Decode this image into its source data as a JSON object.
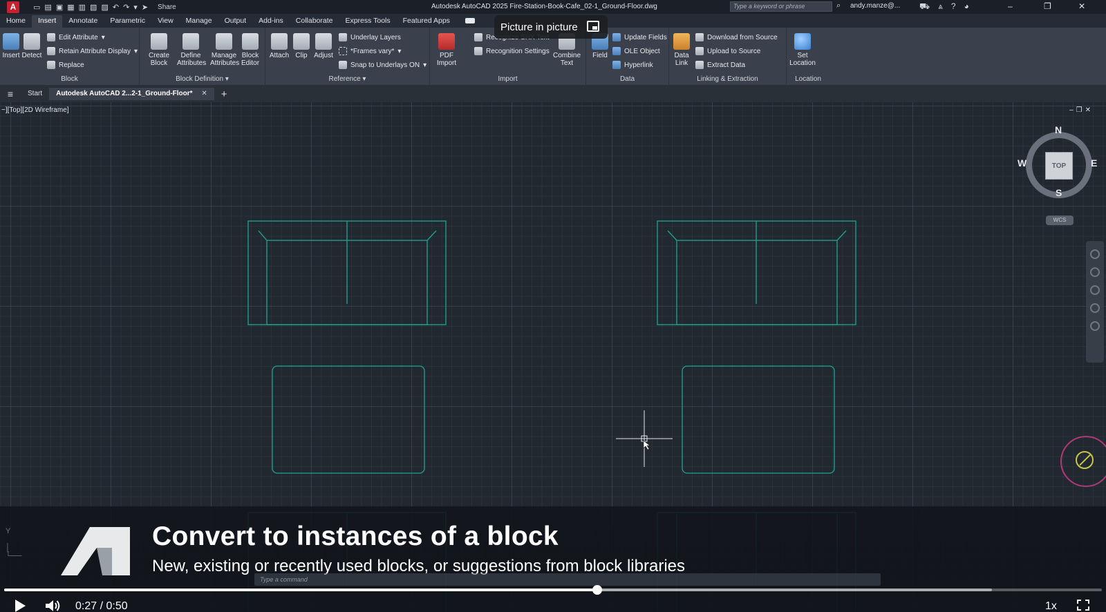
{
  "titlebar": {
    "app_logo": "A",
    "share_label": "Share",
    "title": "Autodesk AutoCAD 2025  Fire-Station-Book-Cafe_02-1_Ground-Floor.dwg",
    "search_placeholder": "Type a keyword or phrase",
    "user": "andy.manze@..."
  },
  "tabs": [
    "Home",
    "Insert",
    "Annotate",
    "Parametric",
    "View",
    "Manage",
    "Output",
    "Add-ins",
    "Collaborate",
    "Express Tools",
    "Featured Apps"
  ],
  "active_tab": "Insert",
  "ribbon": {
    "block": {
      "label": "Block",
      "insert": "Insert",
      "detect": "Detect",
      "edit_attribute": "Edit Attribute",
      "retain_attribute_display": "Retain Attribute Display",
      "replace": "Replace"
    },
    "block_definition": {
      "label": "Block Definition",
      "create_block": [
        "Create",
        "Block"
      ],
      "define_attributes": [
        "Define",
        "Attributes"
      ],
      "manage_attributes": [
        "Manage",
        "Attributes"
      ],
      "block_editor": [
        "Block",
        "Editor"
      ]
    },
    "reference": {
      "label": "Reference",
      "attach": "Attach",
      "clip": "Clip",
      "adjust": "Adjust",
      "underlay_layers": "Underlay Layers",
      "frames_vary": "*Frames vary*",
      "snap_to_underlays": "Snap to Underlays ON"
    },
    "import": {
      "label": "Import",
      "pdf_import": [
        "PDF",
        "Import"
      ],
      "recognize_shx": "Recognize SHX Text",
      "recognition_settings": "Recognition Settings",
      "combine_text": [
        "Combine",
        "Text"
      ]
    },
    "data": {
      "label": "Data",
      "field": "Field",
      "update_fields": "Update Fields",
      "ole_object": "OLE Object",
      "hyperlink": "Hyperlink"
    },
    "linking": {
      "label": "Linking & Extraction",
      "data_link": [
        "Data",
        "Link"
      ],
      "download_from_source": "Download from Source",
      "upload_to_source": "Upload to Source",
      "extract_data": "Extract  Data"
    },
    "location": {
      "label": "Location",
      "set_location": [
        "Set",
        "Location"
      ]
    }
  },
  "filetabs": {
    "start": "Start",
    "active": "Autodesk AutoCAD 2...2-1_Ground-Floor*"
  },
  "viewport": {
    "label": "−][Top][2D Wireframe]",
    "viewcube": {
      "top": "TOP",
      "n": "N",
      "s": "S",
      "e": "E",
      "w": "W"
    },
    "wcs": "WCS"
  },
  "pip": {
    "label": "Picture in picture"
  },
  "caption": {
    "title": "Convert to instances of a block",
    "subtitle": "New, existing or recently used blocks, or suggestions from block libraries",
    "command_placeholder": "Type a command"
  },
  "video": {
    "current_time": "0:27",
    "duration": "0:50",
    "time_text": "0:27  /  0:50",
    "progress": 0.54,
    "buffered": 0.9,
    "speed": "1x"
  },
  "colors": {
    "accent": "#c8202e",
    "geometry": "#1fa58f",
    "canvas": "#212830",
    "ribbon": "#3a414c"
  }
}
